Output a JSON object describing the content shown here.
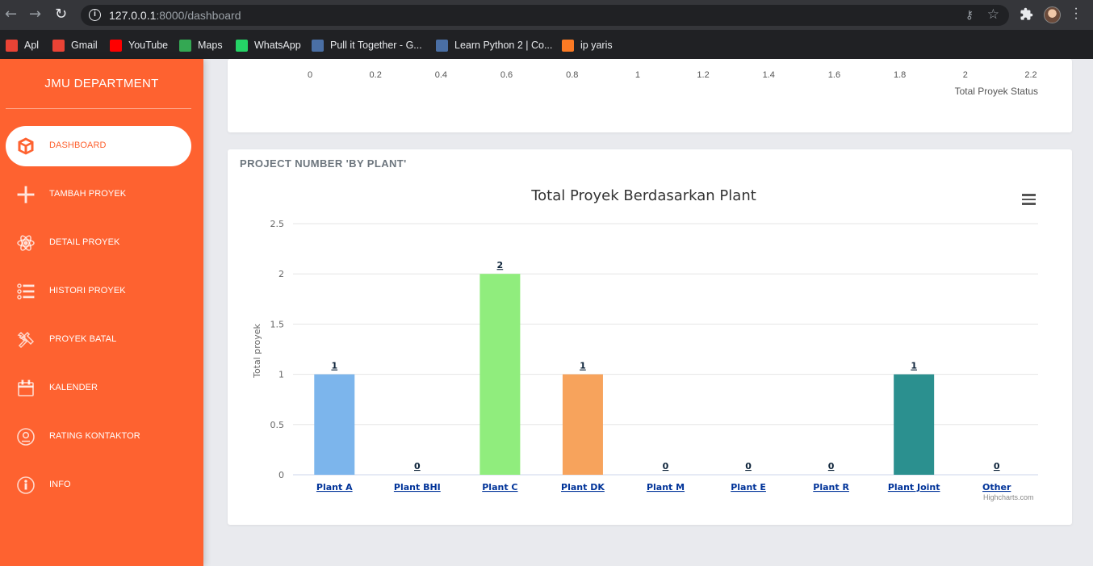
{
  "browser": {
    "url_host": "127.0.0.1",
    "url_path": ":8000/dashboard",
    "bookmarks": [
      {
        "label": "Apl",
        "icon": "apps-grid-icon",
        "color": "#ea4335"
      },
      {
        "label": "Gmail",
        "icon": "gmail-icon",
        "color": "#ea4335"
      },
      {
        "label": "YouTube",
        "icon": "youtube-icon",
        "color": "#ff0000"
      },
      {
        "label": "Maps",
        "icon": "maps-pin-icon",
        "color": "#34a853"
      },
      {
        "label": "WhatsApp",
        "icon": "whatsapp-icon",
        "color": "#25d366"
      },
      {
        "label": "Pull it Together - G...",
        "icon": "page-icon",
        "color": "#4a6fa5"
      },
      {
        "label": "Learn Python 2 | Co...",
        "icon": "page-icon",
        "color": "#4a6fa5"
      },
      {
        "label": "ip yaris",
        "icon": "xampp-icon",
        "color": "#fb7a24"
      }
    ]
  },
  "sidebar": {
    "brand": "JMU DEPARTMENT",
    "items": [
      {
        "label": "DASHBOARD",
        "icon": "box-icon",
        "active": true
      },
      {
        "label": "TAMBAH PROYEK",
        "icon": "plus-icon",
        "active": false
      },
      {
        "label": "DETAIL PROYEK",
        "icon": "atom-icon",
        "active": false
      },
      {
        "label": "HISTORI PROYEK",
        "icon": "list-icon",
        "active": false
      },
      {
        "label": "PROYEK BATAL",
        "icon": "tools-icon",
        "active": false
      },
      {
        "label": "KALENDER",
        "icon": "calendar-icon",
        "active": false
      },
      {
        "label": "RATING KONTAKTOR",
        "icon": "user-circle-icon",
        "active": false
      },
      {
        "label": "INFO",
        "icon": "info-icon",
        "active": false
      }
    ],
    "colors": {
      "background": "#fe6230",
      "active_bg": "#ffffff"
    }
  },
  "status_chart_partial": {
    "x_ticks": [
      "0",
      "0.2",
      "0.4",
      "0.6",
      "0.8",
      "1",
      "1.2",
      "1.4",
      "1.6",
      "1.8",
      "2",
      "2.2"
    ],
    "xlabel": "Total Proyek Status"
  },
  "plant_card": {
    "title": "PROJECT NUMBER 'BY PLANT'",
    "credits": "Highcharts.com"
  },
  "chart_data": {
    "type": "bar",
    "title": "Total Proyek Berdasarkan Plant",
    "xlabel": "",
    "ylabel": "Total proyek",
    "ylim": [
      0,
      2.5
    ],
    "y_ticks": [
      0,
      0.5,
      1,
      1.5,
      2,
      2.5
    ],
    "y_tick_labels": [
      "0",
      "0.5",
      "1",
      "1.5",
      "2",
      "2.5"
    ],
    "grid": true,
    "categories": [
      "Plant A",
      "Plant BHI",
      "Plant C",
      "Plant DK",
      "Plant M",
      "Plant E",
      "Plant R",
      "Plant Joint",
      "Other"
    ],
    "values": [
      1,
      0,
      2,
      1,
      0,
      0,
      0,
      1,
      0
    ],
    "colors": [
      "#7cb5ec",
      "#434348",
      "#90ed7d",
      "#f7a35c",
      "#8085e9",
      "#f15c80",
      "#e4d354",
      "#2b908f",
      "#f45b5b"
    ]
  }
}
